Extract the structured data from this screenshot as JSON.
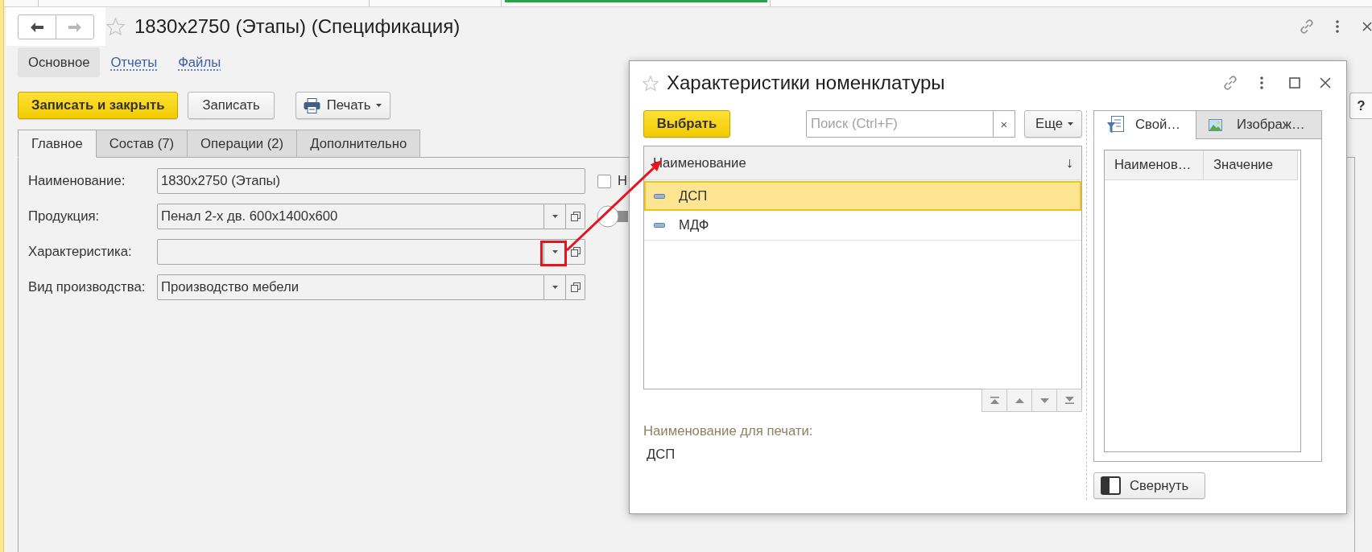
{
  "history_buttons": [
    {
      "kind": "back",
      "disabled": false
    },
    {
      "kind": "forward",
      "disabled": true
    }
  ],
  "window": {
    "title": "1830x2750 (Этапы) (Спецификация)"
  },
  "sections": [
    {
      "label": "Основное",
      "selected": true
    },
    {
      "label": "Отчеты",
      "selected": false
    },
    {
      "label": "Файлы",
      "selected": false
    }
  ],
  "toolbar": {
    "buttons": [
      {
        "label": "Записать и закрыть",
        "kind": "primary"
      },
      {
        "label": "Записать",
        "kind": "plain"
      },
      {
        "label": "Печать",
        "kind": "print_menu"
      }
    ],
    "help": "?"
  },
  "tabs": [
    {
      "label": "Главное",
      "selected": true
    },
    {
      "label": "Состав (7)",
      "selected": false
    },
    {
      "label": "Операции (2)",
      "selected": false
    },
    {
      "label": "Дополнительно",
      "selected": false
    }
  ],
  "fields": [
    {
      "label": "Наименование:",
      "kind": "text",
      "value": "1830x2750 (Этапы)",
      "marked": false,
      "checkbox": {
        "label": "Н",
        "checked": false
      }
    },
    {
      "label": "Продукция:",
      "kind": "choice",
      "value": "Пенал 2-х дв. 600x1400x600",
      "marked": false,
      "switch": {
        "on": false
      }
    },
    {
      "label": "Характеристика:",
      "kind": "choice",
      "marked": true
    },
    {
      "label": "Вид производства:",
      "kind": "choice",
      "value": "Производство мебели",
      "marked": false
    }
  ],
  "dialog": {
    "title": "Характеристики номенклатуры",
    "select_button": "Выбрать",
    "search": {
      "placeholder": "Поиск (Ctrl+F)",
      "clear": "×"
    },
    "more_button": "Еще",
    "list": {
      "column": "Наименование",
      "sort_mark": "↓",
      "rows": [
        {
          "name": "ДСП",
          "selected": true
        },
        {
          "name": "МДФ",
          "selected": false
        }
      ]
    },
    "print_name": {
      "label": "Наименование для печати:",
      "value": "ДСП"
    },
    "side_tabs": [
      {
        "label": "Свой…",
        "kind": "properties",
        "selected": true
      },
      {
        "label": "Изображ…",
        "kind": "images",
        "selected": false
      }
    ],
    "properties_table": {
      "columns": [
        "Наименов…",
        "Значение"
      ]
    },
    "collapse_button": "Свернуть"
  }
}
